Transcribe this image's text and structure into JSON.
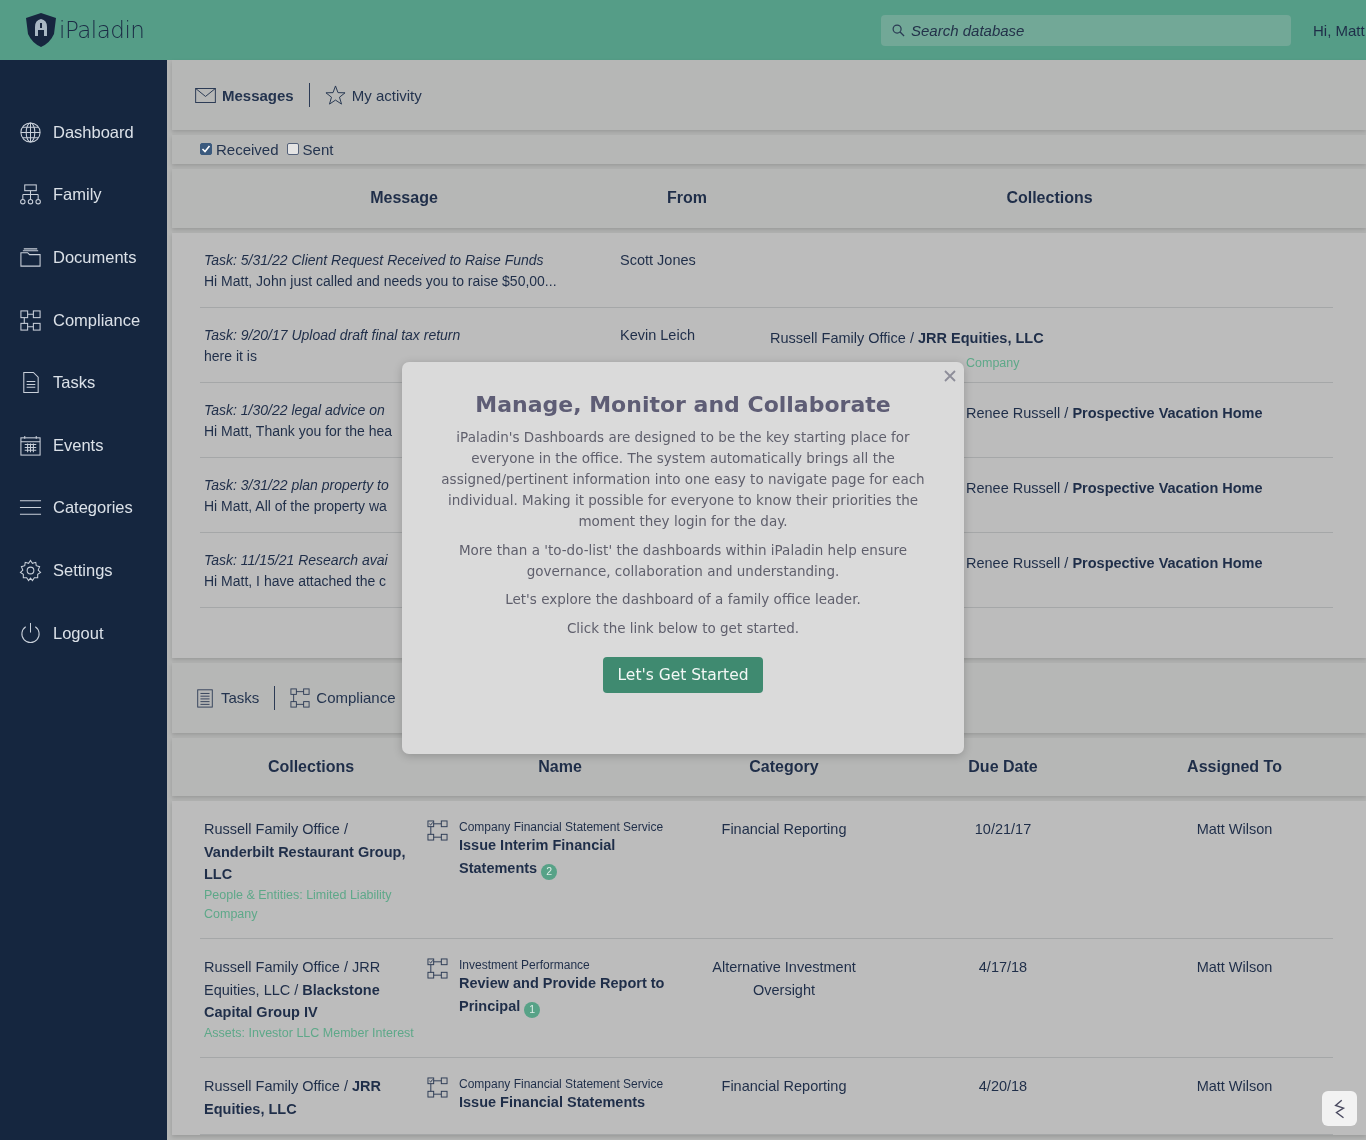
{
  "header": {
    "logo_text": "iPaladin",
    "search": {
      "placeholder": "Search database"
    },
    "greeting": "Hi, Matt"
  },
  "sidebar": {
    "items": [
      {
        "label": "Dashboard",
        "selected": false
      },
      {
        "label": "Family",
        "selected": false
      },
      {
        "label": "Documents",
        "selected": false
      },
      {
        "label": "Compliance",
        "selected": false
      },
      {
        "label": "Tasks",
        "selected": false
      },
      {
        "label": "Events",
        "selected": false
      },
      {
        "label": "Categories",
        "selected": false
      },
      {
        "label": "Settings",
        "selected": false
      },
      {
        "label": "Logout",
        "selected": false
      }
    ]
  },
  "top_tabs": [
    {
      "label": "Messages",
      "selected": true
    },
    {
      "label": "My activity",
      "selected": false
    }
  ],
  "filters": [
    {
      "label": "Received",
      "checked": true
    },
    {
      "label": "Sent",
      "checked": false
    }
  ],
  "messages": {
    "columns": [
      "Message",
      "From",
      "Collections"
    ],
    "rows": [
      {
        "title": "Task: 5/31/22 Client Request Received to Raise Funds",
        "body": "Hi Matt, John just called and needs you to raise $50,00...",
        "from": "Scott Jones"
      },
      {
        "title": "Task: 9/20/17 Upload draft final tax return",
        "body": "here it is",
        "from": "Kevin Leich",
        "collection": "Russell Family Office / **JRR Equities, LLC**",
        "collection_type": "Company"
      },
      {
        "title": "Task: 1/30/22 legal advice on",
        "body": "Hi Matt, Thank you for the hea",
        "collection": "Renee Russell / **Prospective Vacation Home**"
      },
      {
        "title": "Task: 3/31/22 plan property to",
        "body": "Hi Matt, All of the property wa",
        "collection": "Renee Russell / **Prospective Vacation Home**"
      },
      {
        "title": "Task: 11/15/21 Research avai",
        "body": "Hi Matt, I have attached the c",
        "collection": "Renee Russell / **Prospective Vacation Home**"
      }
    ]
  },
  "bottom_tabs": [
    {
      "label": "Tasks",
      "selected": false
    },
    {
      "label": "Compliance",
      "selected": false
    }
  ],
  "tasks": {
    "columns": [
      "Collections",
      "Name",
      "Category",
      "Due Date",
      "Assigned To"
    ],
    "rows": [
      {
        "collection": "Russell Family Office / **Vanderbilt Restaurant Group, LLC**",
        "collection_type": "People & Entities: Limited Liability Company",
        "group": "Company Financial Statement Service",
        "name": "Issue Interim Financial Statements",
        "count": "2",
        "category": "Financial Reporting",
        "due": "10/21/17",
        "assigned": "Matt Wilson"
      },
      {
        "collection": "Russell Family Office / JRR Equities, LLC / **Blackstone Capital Group IV**",
        "collection_type": "Assets: Investor LLC Member Interest",
        "group": "Investment Performance",
        "name": "Review and Provide Report to Principal",
        "count": "1",
        "category": "Alternative Investment Oversight",
        "due": "4/17/18",
        "assigned": "Matt Wilson"
      },
      {
        "collection": "Russell Family Office / **JRR Equities, LLC**",
        "group": "Company Financial Statement Service",
        "name": "Issue Financial Statements",
        "category": "Financial Reporting",
        "due": "4/20/18",
        "assigned": "Matt Wilson"
      }
    ]
  },
  "modal": {
    "title": "Manage, Monitor and Collaborate",
    "paragraphs": [
      "iPaladin's Dashboards are designed to be the key starting place for everyone in the office. The system automatically brings all the assigned/pertinent information into one easy to navigate page for each individual. Making it possible for everyone to know their priorities the moment they login for the day.",
      "More than a 'to-do-list' the dashboards within iPaladin help ensure governance, collaboration and understanding.",
      "Let's explore the dashboard of a family office leader.",
      "Click the link below to get started."
    ],
    "button": "Let's Get Started"
  }
}
